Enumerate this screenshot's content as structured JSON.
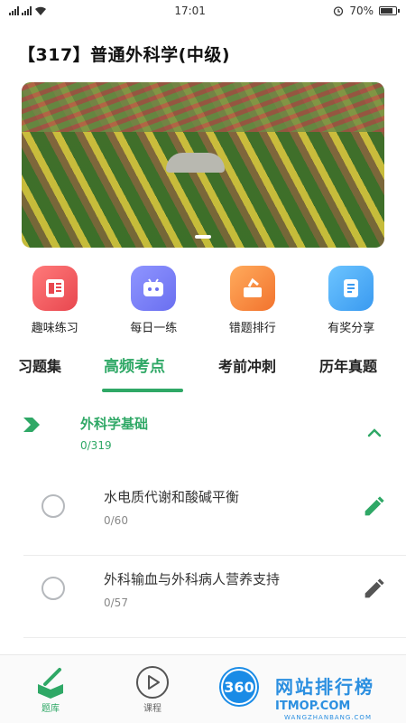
{
  "status_bar": {
    "time": "17:01",
    "battery": "70%"
  },
  "title": "【317】普通外科学(中级)",
  "banner": {
    "image": "vineyard-banner"
  },
  "quick_actions": [
    {
      "label": "趣味练习",
      "icon": "practice-icon",
      "color": "#e8474f"
    },
    {
      "label": "每日一练",
      "icon": "daily-icon",
      "color": "#6a6ff0"
    },
    {
      "label": "错题排行",
      "icon": "wrong-ranking-icon",
      "color": "#f2732e"
    },
    {
      "label": "有奖分享",
      "icon": "share-icon",
      "color": "#3a9af0"
    }
  ],
  "tabs": [
    {
      "label": "习题集",
      "active": false
    },
    {
      "label": "高频考点",
      "active": true
    },
    {
      "label": "考前冲刺",
      "active": false
    },
    {
      "label": "历年真题",
      "active": false
    }
  ],
  "section": {
    "title": "外科学基础",
    "progress": "0/319"
  },
  "items": [
    {
      "name": "水电质代谢和酸碱平衡",
      "progress": "0/60",
      "edit_color": "#2fa866"
    },
    {
      "name": "外科输血与外科病人营养支持",
      "progress": "0/57",
      "edit_color": "#555555"
    }
  ],
  "bottom_nav": [
    {
      "label": "题库",
      "icon": "question-bank-icon",
      "active": true
    },
    {
      "label": "课程",
      "icon": "play-icon",
      "active": false
    }
  ],
  "watermark": {
    "logo": "360",
    "text": "网站排行榜",
    "sub": "ITMOP.COM",
    "sub2": "WANGZHANBANG.COM"
  },
  "colors": {
    "accent": "#2fa866",
    "text": "#222222",
    "muted": "#888888"
  }
}
